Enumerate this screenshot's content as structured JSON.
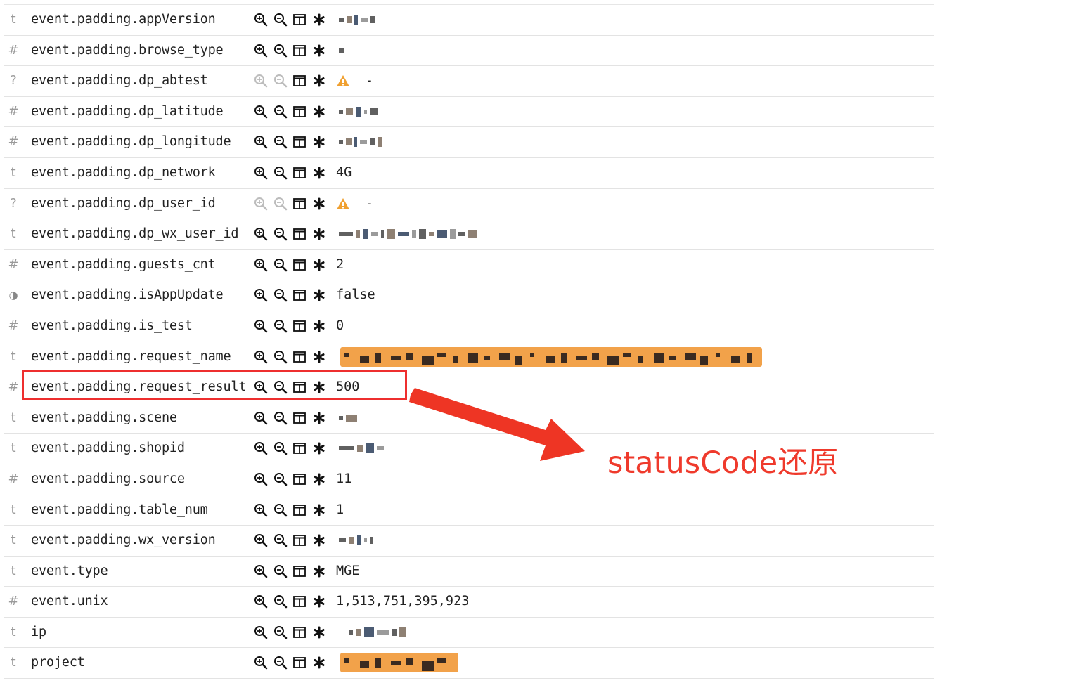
{
  "rows": [
    {
      "type": "t",
      "field": "event.padding.appVersion",
      "value": "",
      "redacted": true,
      "warn": false
    },
    {
      "type": "#",
      "field": "event.padding.browse_type",
      "value": "",
      "redacted": true,
      "warn": false
    },
    {
      "type": "?",
      "field": "event.padding.dp_abtest",
      "value": "-",
      "redacted": false,
      "warn": true
    },
    {
      "type": "#",
      "field": "event.padding.dp_latitude",
      "value": "",
      "redacted": true,
      "warn": false
    },
    {
      "type": "#",
      "field": "event.padding.dp_longitude",
      "value": "",
      "redacted": true,
      "warn": false
    },
    {
      "type": "t",
      "field": "event.padding.dp_network",
      "value": "4G",
      "redacted": false,
      "warn": false
    },
    {
      "type": "?",
      "field": "event.padding.dp_user_id",
      "value": "-",
      "redacted": false,
      "warn": true
    },
    {
      "type": "t",
      "field": "event.padding.dp_wx_user_id",
      "value": "",
      "redacted": true,
      "warn": false
    },
    {
      "type": "#",
      "field": "event.padding.guests_cnt",
      "value": "2",
      "redacted": false,
      "warn": false
    },
    {
      "type": "◑",
      "field": "event.padding.isAppUpdate",
      "value": "false",
      "redacted": false,
      "warn": false
    },
    {
      "type": "#",
      "field": "event.padding.is_test",
      "value": "0",
      "redacted": false,
      "warn": false
    },
    {
      "type": "t",
      "field": "event.padding.request_name",
      "value": "",
      "redacted": true,
      "warn": false
    },
    {
      "type": "#",
      "field": "event.padding.request_result",
      "value": "500",
      "redacted": false,
      "warn": false
    },
    {
      "type": "t",
      "field": "event.padding.scene",
      "value": "",
      "redacted": true,
      "warn": false
    },
    {
      "type": "t",
      "field": "event.padding.shopid",
      "value": "",
      "redacted": true,
      "warn": false
    },
    {
      "type": "#",
      "field": "event.padding.source",
      "value": "11",
      "redacted": false,
      "warn": false
    },
    {
      "type": "t",
      "field": "event.padding.table_num",
      "value": "1",
      "redacted": false,
      "warn": false
    },
    {
      "type": "t",
      "field": "event.padding.wx_version",
      "value": "",
      "redacted": true,
      "warn": false
    },
    {
      "type": "t",
      "field": "event.type",
      "value": "MGE",
      "redacted": false,
      "warn": false
    },
    {
      "type": "#",
      "field": "event.unix",
      "value": "1,513,751,395,923",
      "redacted": false,
      "warn": false
    },
    {
      "type": "t",
      "field": "ip",
      "value": "",
      "redacted": true,
      "warn": false
    },
    {
      "type": "t",
      "field": "project",
      "value": "",
      "redacted": true,
      "warn": false
    }
  ],
  "annotation": {
    "text": "statusCode还原",
    "color": "#ef3a2c"
  },
  "icons": [
    "zoom-in-icon",
    "zoom-out-icon",
    "toggle-column-icon",
    "filter-exists-icon",
    "warning-icon"
  ],
  "colors": {
    "warning": "#f0a030",
    "highlight": "#f2a24a",
    "annotation_red": "#ee2f2f"
  }
}
